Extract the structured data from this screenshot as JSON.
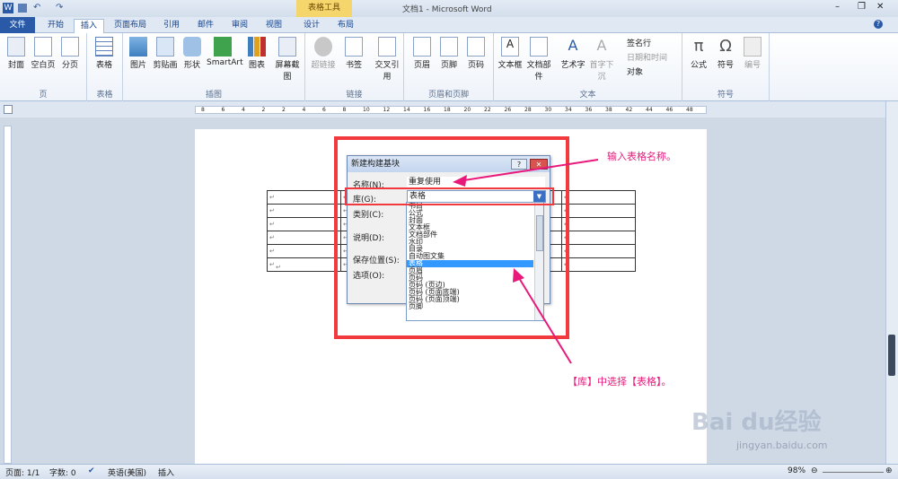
{
  "window": {
    "title": "文档1 - Microsoft Word",
    "context_tool": "表格工具"
  },
  "tabs": [
    "文件",
    "开始",
    "插入",
    "页面布局",
    "引用",
    "邮件",
    "审阅",
    "视图",
    "设计",
    "布局"
  ],
  "ribbon": {
    "groups": [
      {
        "label": "页",
        "buttons": [
          "封面",
          "空白页",
          "分页"
        ]
      },
      {
        "label": "表格",
        "buttons": [
          "表格"
        ]
      },
      {
        "label": "插图",
        "buttons": [
          "图片",
          "剪贴画",
          "形状",
          "SmartArt",
          "图表",
          "屏幕截图"
        ]
      },
      {
        "label": "链接",
        "buttons": [
          "超链接",
          "书签",
          "交叉引用"
        ]
      },
      {
        "label": "页眉和页脚",
        "buttons": [
          "页眉",
          "页脚",
          "页码"
        ]
      },
      {
        "label": "文本",
        "buttons": [
          "文本框",
          "文档部件",
          "艺术字",
          "首字下沉"
        ]
      },
      {
        "label": "符号",
        "buttons": [
          "公式",
          "符号",
          "编号"
        ]
      }
    ],
    "text_small": [
      "签名行",
      "日期和时间",
      "对象"
    ]
  },
  "ruler": {
    "ticks": [
      "8",
      "6",
      "4",
      "2",
      "2",
      "4",
      "6",
      "8",
      "10",
      "12",
      "14",
      "16",
      "18",
      "20",
      "22",
      "26",
      "28",
      "30",
      "34",
      "36",
      "38",
      "42",
      "44",
      "46",
      "48"
    ]
  },
  "dialog": {
    "title": "新建构建基块",
    "name_label": "名称(N):",
    "name_value": "重复使用",
    "gallery_label": "库(G):",
    "gallery_value": "表格",
    "category_label": "类别(C):",
    "description_label": "说明(D):",
    "save_label": "保存位置(S):",
    "options_label": "选项(O):",
    "list_items": [
      "书目",
      "公式",
      "封面",
      "文本框",
      "文档部件",
      "水印",
      "目录",
      "自动图文集",
      "表格",
      "页眉",
      "页码",
      "页码 (页边)",
      "页码 (页面底端)",
      "页码 (页面顶端)",
      "页脚"
    ],
    "selected_index": 8
  },
  "annotations": {
    "top": "输入表格名称。",
    "bottom": "【库】中选择【表格】。"
  },
  "status": {
    "page": "页面: 1/1",
    "words": "字数: 0",
    "lang": "英语(美国)",
    "mode": "插入",
    "zoom": "98%"
  },
  "watermark": {
    "main": "Bai du经验",
    "sub": "jingyan.baidu.com"
  },
  "colors": {
    "annotation": "#e8197a",
    "highlight_box": "#f2393d",
    "selection": "#3399ff",
    "file_tab": "#2a5aa7"
  }
}
